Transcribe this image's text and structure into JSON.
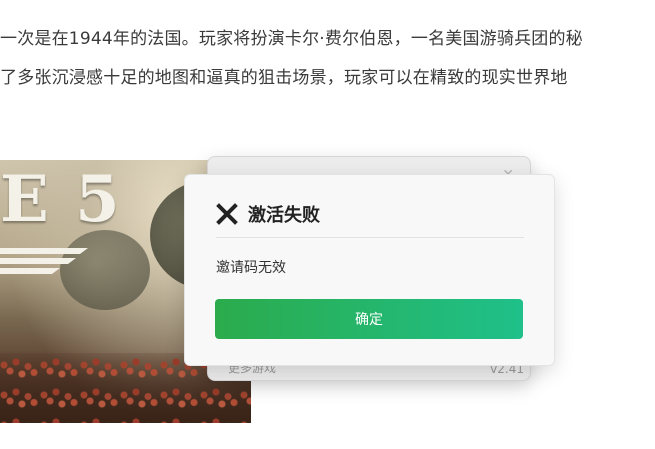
{
  "article": {
    "line1": "一次是在1944年的法国。玩家将扮演卡尔·费尔伯恩，一名美国游骑兵团的秘",
    "line2": "了多张沉浸感十足的地图和逼真的狙击场景，玩家可以在精致的现实世界地"
  },
  "game_image": {
    "logo_text": "E 5"
  },
  "back_panel": {
    "more_games": "更多游戏",
    "version": "v2.41"
  },
  "dialog": {
    "title": "激活失败",
    "message": "邀请码无效",
    "confirm_label": "确定"
  },
  "colors": {
    "confirm_start": "#2bab4c",
    "confirm_end": "#1fc08a",
    "title_text": "#222222"
  },
  "icons": {
    "dialog_close": "close-x-icon"
  }
}
